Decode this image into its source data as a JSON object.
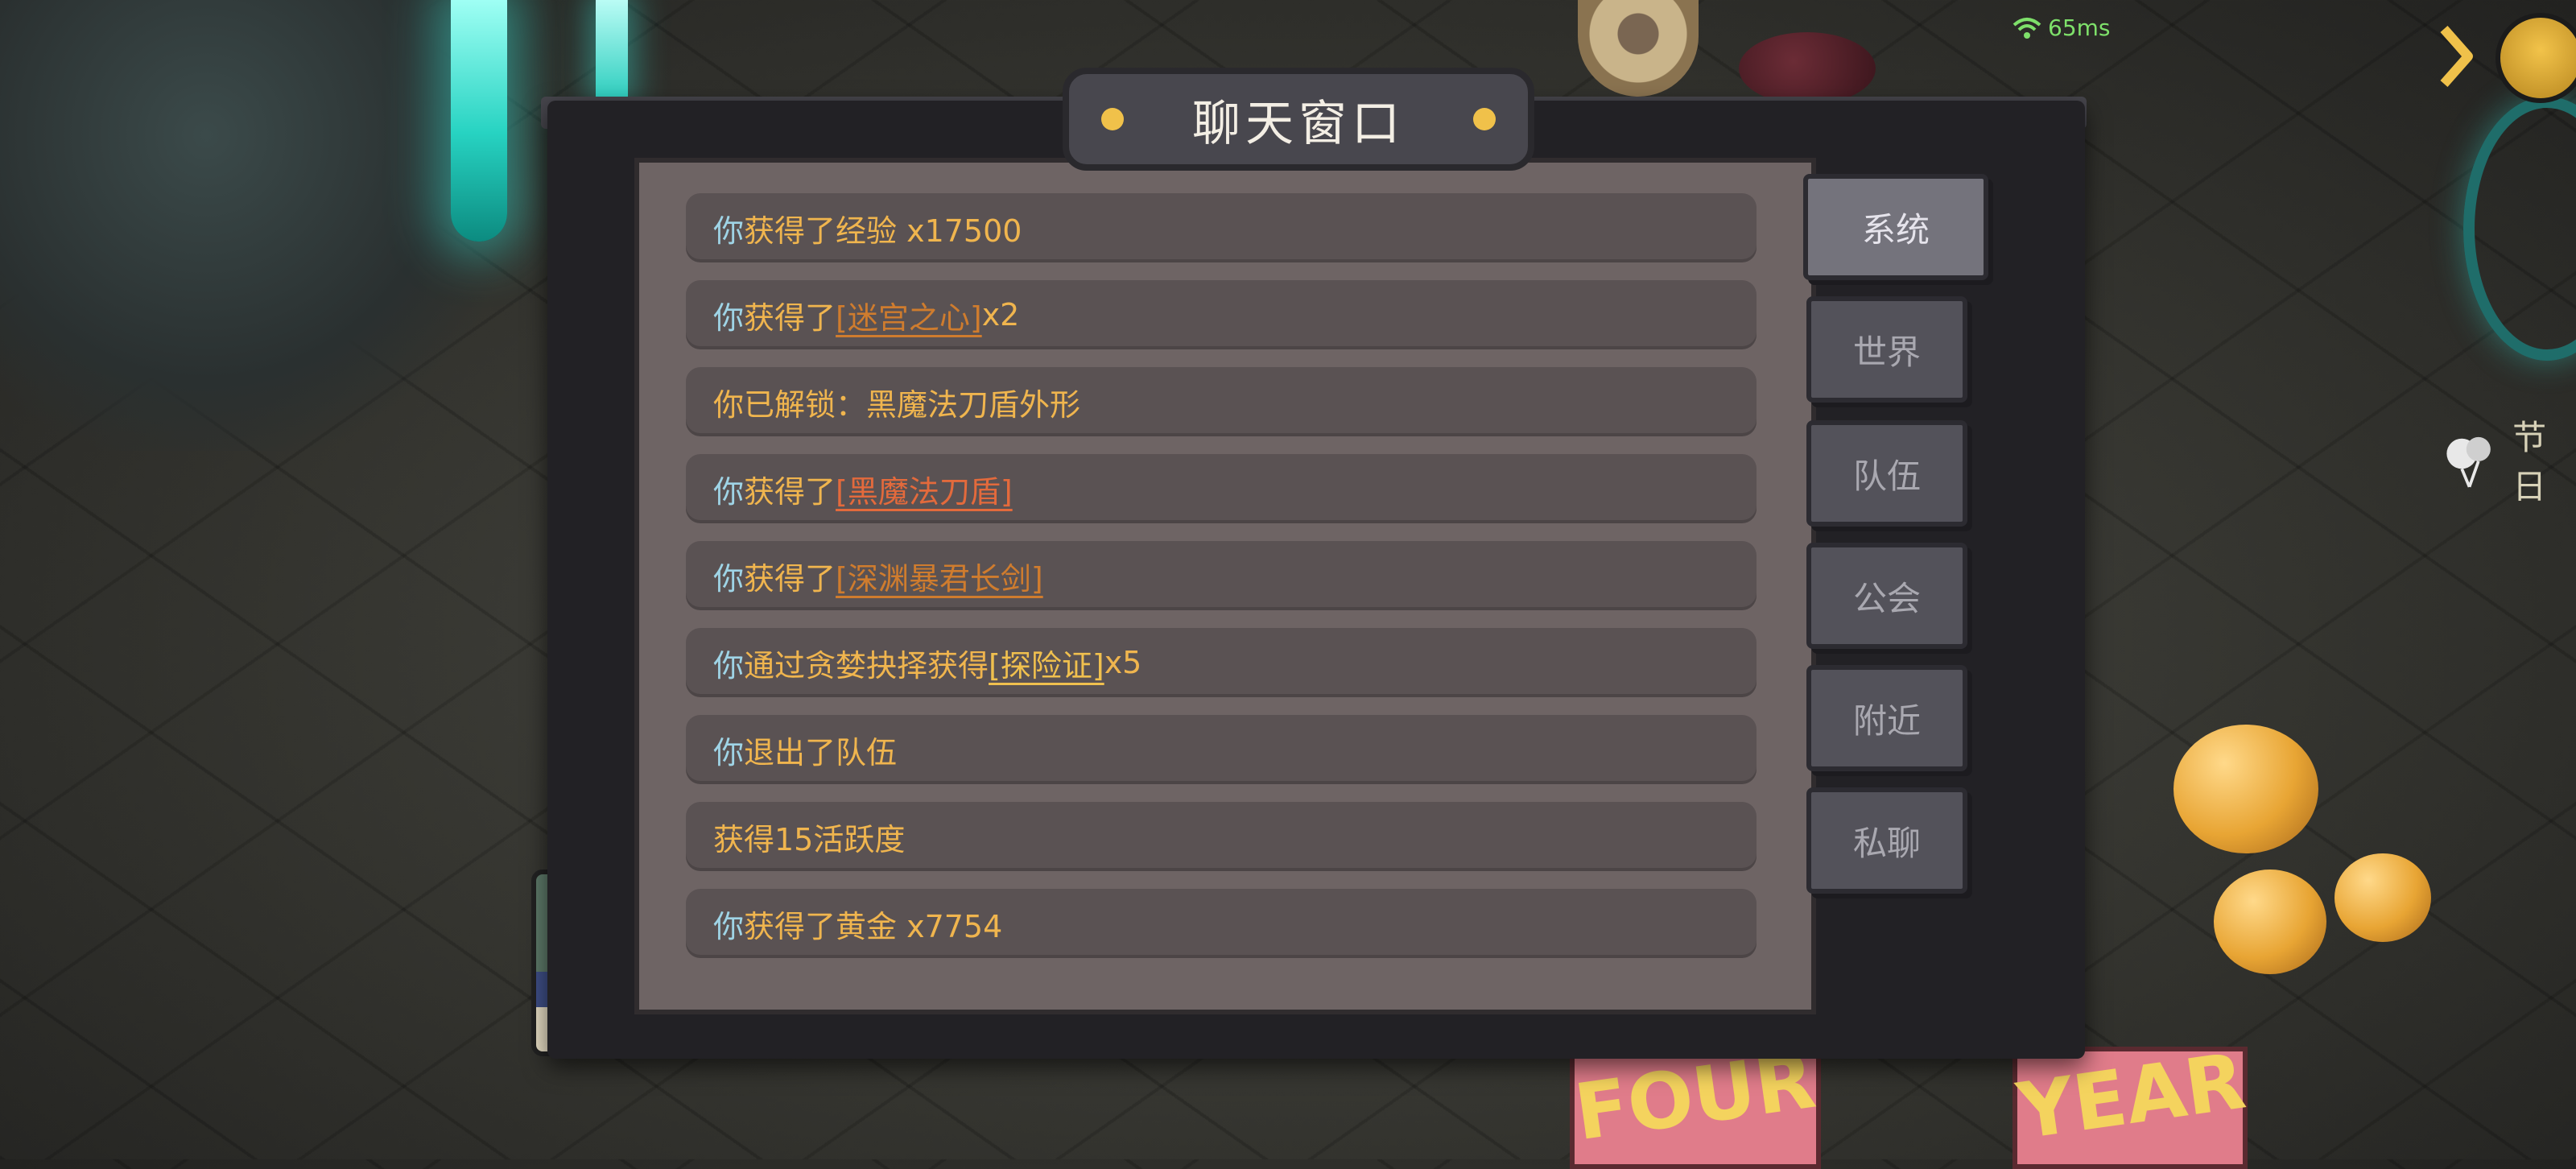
{
  "hud": {
    "ping": "65ms",
    "festival_label": "节日"
  },
  "chat_window": {
    "title": "聊天窗口",
    "messages": [
      {
        "you": "你",
        "parts": [
          "获得了经验  x17500"
        ],
        "item": "",
        "tail": ""
      },
      {
        "you": "你",
        "parts": [
          "获得了"
        ],
        "item": "[迷宫之心]",
        "tail": " x2",
        "item_color": "purple"
      },
      {
        "you": "",
        "parts": [
          "你已解锁：黑魔法刀盾外形"
        ],
        "item": "",
        "tail": ""
      },
      {
        "you": "你",
        "parts": [
          "获得了"
        ],
        "item": "[黑魔法刀盾]",
        "tail": "",
        "item_color": "red"
      },
      {
        "you": "你",
        "parts": [
          "获得了"
        ],
        "item": "[深渊暴君长剑]",
        "tail": "",
        "item_color": "purple"
      },
      {
        "you": "你",
        "parts": [
          "通过贪婪抉择获得"
        ],
        "item": "[探险证]",
        "tail": " x5",
        "item_color": "yellow"
      },
      {
        "you": "你",
        "parts": [
          "退出了队伍"
        ],
        "item": "",
        "tail": ""
      },
      {
        "you": "",
        "parts": [
          "获得15活跃度"
        ],
        "item": "",
        "tail": ""
      },
      {
        "you": "你",
        "parts": [
          "获得了黄金  x7754"
        ],
        "item": "",
        "tail": ""
      }
    ],
    "tabs": [
      {
        "label": "系统",
        "active": true
      },
      {
        "label": "世界",
        "active": false
      },
      {
        "label": "队伍",
        "active": false
      },
      {
        "label": "公会",
        "active": false
      },
      {
        "label": "附近",
        "active": false
      },
      {
        "label": "私聊",
        "active": false
      }
    ]
  },
  "scene": {
    "banner_words": [
      "FOUR",
      "YEAR"
    ]
  },
  "colors": {
    "you_name": "#9fd4e6",
    "message_text": "#f0b54e",
    "item_purple": "#cf7c2e",
    "item_red": "#e36a3c",
    "item_yellow": "#f0c04e",
    "ping_green": "#7ee06a"
  }
}
